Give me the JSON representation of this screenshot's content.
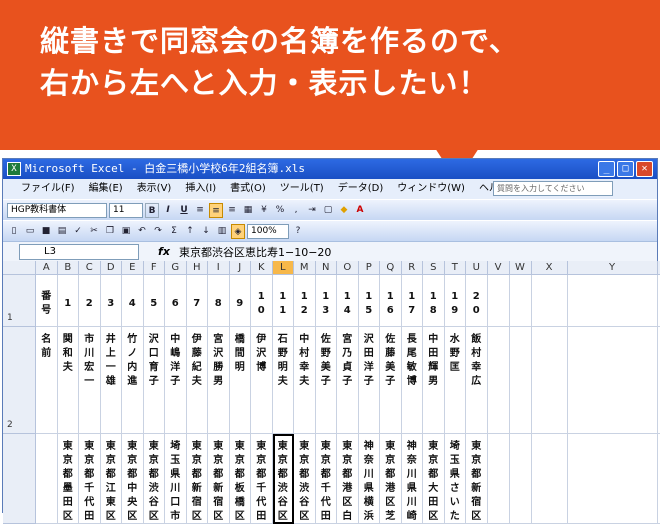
{
  "callout": {
    "line1": "縦書きで同窓会の名簿を作るので、",
    "line2": "右から左へと入力・表示したい！"
  },
  "window": {
    "title": "Microsoft Excel - 白金三橋小学校6年2組名簿.xls",
    "app_icon": "X"
  },
  "menu": [
    "ファイル(F)",
    "編集(E)",
    "表示(V)",
    "挿入(I)",
    "書式(O)",
    "ツール(T)",
    "データ(D)",
    "ウィンドウ(W)",
    "ヘルプ(H)"
  ],
  "help_placeholder": "質問を入力してください",
  "toolbar1": {
    "font": "HGP教科書体",
    "size": "11"
  },
  "toolbar2": {
    "zoom": "100%"
  },
  "formula_bar": {
    "name_box": "L3",
    "fx": "fx",
    "value": "東京都渋谷区恵比寿1−10−20"
  },
  "columns": [
    "A",
    "B",
    "C",
    "D",
    "E",
    "F",
    "G",
    "H",
    "I",
    "J",
    "K",
    "L",
    "M",
    "N",
    "O",
    "P",
    "Q",
    "R",
    "S",
    "T",
    "U",
    "V",
    "W",
    "X",
    "Y",
    "Z"
  ],
  "active_column": "L",
  "rows": {
    "r1": "1",
    "r2": "2",
    "r3": ""
  },
  "row1": [
    "番号",
    "1",
    "2",
    "3",
    "4",
    "5",
    "6",
    "7",
    "8",
    "9",
    "10",
    "11",
    "12",
    "13",
    "14",
    "15",
    "16",
    "17",
    "18",
    "19",
    "20"
  ],
  "row2": [
    "名前",
    "関和夫",
    "市川宏一",
    "井上一雄",
    "竹ノ内進",
    "沢口育子",
    "中嶋洋子",
    "伊藤紀夫",
    "宮沢勝男",
    "橋間明",
    "伊沢博",
    "石野明夫",
    "中村幸夫",
    "佐野美子",
    "宮乃貞子",
    "沢田洋子",
    "佐藤美子",
    "長尾敏博",
    "中田輝男",
    "水野匡",
    "飯村幸広"
  ],
  "row3": [
    "",
    "東京都墨田区",
    "東京都千代田",
    "東京都江東区",
    "東京都中央区",
    "東京都渋谷区",
    "埼玉県川口市",
    "東京都新宿区",
    "東京都新宿区",
    "東京都板橋区",
    "東京都千代田",
    "東京都渋谷区",
    "東京都渋谷区",
    "東京都千代田",
    "東京都港区白",
    "神奈川県横浜",
    "東京都港区芝",
    "神奈川県川崎",
    "東京都大田区",
    "埼玉県さいた",
    "東京都新宿区"
  ]
}
